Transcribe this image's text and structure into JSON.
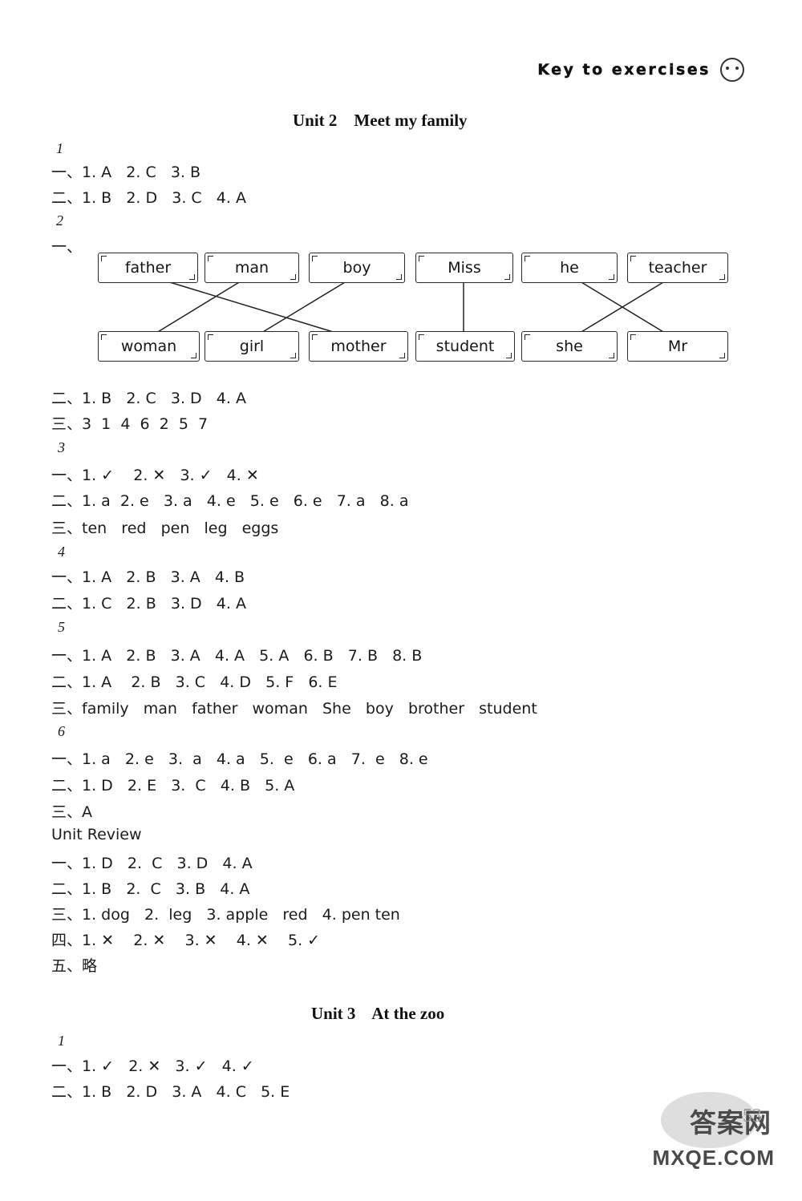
{
  "header": {
    "title": "Key to exercises"
  },
  "units": [
    {
      "id": "unit2",
      "title": "Unit 2    Meet my family"
    },
    {
      "id": "unit3",
      "title": "Unit 3    At the zoo"
    }
  ],
  "sections": {
    "s1": {
      "number": "1",
      "lines": [
        "一、1. A   2. C   3. B",
        "二、1. B   2. D   3. C   4. A"
      ]
    },
    "s2": {
      "number": "2",
      "prefix": "一、",
      "top_words": [
        "father",
        "man",
        "boy",
        "Miss",
        "he",
        "teacher"
      ],
      "bottom_words": [
        "woman",
        "girl",
        "mother",
        "student",
        "she",
        "Mr"
      ],
      "lines": [
        "二、1. B   2. C   3. D   4. A",
        "三、3  1  4  6  2  5  7"
      ]
    },
    "s3": {
      "number": "3",
      "lines": [
        "一、1. ✓    2. ✕   3. ✓   4. ✕",
        "二、1. a  2. e   3. a   4. e   5. e   6. e   7. a   8. a",
        "三、ten   red   pen   leg   eggs"
      ]
    },
    "s4": {
      "number": "4",
      "lines": [
        "一、1. A   2. B   3. A   4. B",
        "二、1. C   2. B   3. D   4. A"
      ]
    },
    "s5": {
      "number": "5",
      "lines": [
        "一、1. A   2. B   3. A   4. A   5. A   6. B   7. B   8. B",
        "二、1. A    2. B   3. C   4. D   5. F   6. E",
        "三、family   man   father   woman   She   boy   brother   student"
      ]
    },
    "s6": {
      "number": "6",
      "lines": [
        "一、1. a   2. e   3.  a   4. a   5.  e   6. a   7.  e   8. e",
        "二、1. D   2. E   3.  C   4. B   5. A",
        "三、A"
      ]
    },
    "review": {
      "title": "Unit Review",
      "lines": [
        "一、1. D   2.  C   3. D   4. A",
        "二、1. B   2.  C   3. B   4. A",
        "三、1. dog   2.  leg   3. apple   red   4. pen ten",
        "四、1. ✕    2. ✕    3. ✕    4. ✕    5. ✓",
        "五、略"
      ]
    },
    "s7": {
      "number": "1",
      "lines": [
        "一、1. ✓   2. ✕   3. ✓   4. ✓",
        "二、1. B   2. D   3. A   4. C   5. E"
      ]
    }
  },
  "watermark": {
    "chinese": "答案网",
    "url": "MXQE.COM"
  },
  "page_number": "53"
}
